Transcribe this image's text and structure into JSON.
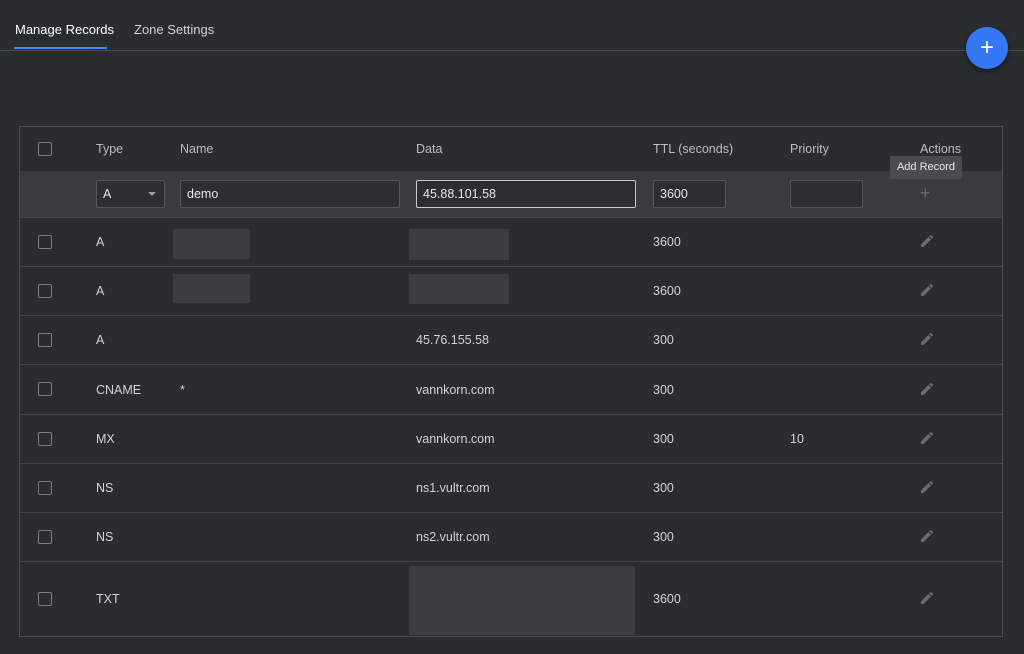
{
  "tabs": [
    {
      "label": "Manage Records"
    },
    {
      "label": "Zone Settings"
    }
  ],
  "fab_icon": "plus-icon",
  "table": {
    "headers": {
      "type": "Type",
      "name": "Name",
      "data": "Data",
      "ttl": "TTL (seconds)",
      "priority": "Priority",
      "actions": "Actions"
    },
    "add_row": {
      "type_value": "A",
      "name_value": "demo",
      "data_value": "45.88.101.58",
      "ttl_value": "3600",
      "priority_value": "",
      "tooltip": "Add Record"
    },
    "records": [
      {
        "type": "A",
        "name": "",
        "data": "",
        "ttl": "3600",
        "priority": ""
      },
      {
        "type": "A",
        "name": "",
        "data": "",
        "ttl": "3600",
        "priority": ""
      },
      {
        "type": "A",
        "name": "",
        "data": "45.76.155.58",
        "ttl": "300",
        "priority": ""
      },
      {
        "type": "CNAME",
        "name": "*",
        "data": "vannkorn.com",
        "ttl": "300",
        "priority": ""
      },
      {
        "type": "MX",
        "name": "",
        "data": "vannkorn.com",
        "ttl": "300",
        "priority": "10"
      },
      {
        "type": "NS",
        "name": "",
        "data": "ns1.vultr.com",
        "ttl": "300",
        "priority": ""
      },
      {
        "type": "NS",
        "name": "",
        "data": "ns2.vultr.com",
        "ttl": "300",
        "priority": ""
      },
      {
        "type": "TXT",
        "name": "",
        "data": "",
        "ttl": "3600",
        "priority": ""
      }
    ]
  },
  "colors": {
    "accent": "#3478f6",
    "background": "#2b2c30"
  }
}
